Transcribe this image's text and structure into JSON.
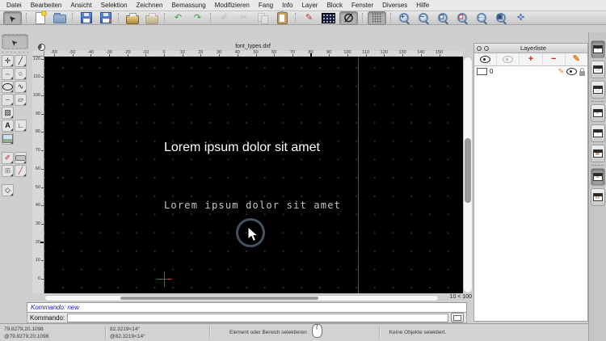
{
  "menubar": {
    "items": [
      "Datei",
      "Bearbeiten",
      "Ansicht",
      "Selektion",
      "Zeichnen",
      "Bemassung",
      "Modifizieren",
      "Fang",
      "Info",
      "Layer",
      "Block",
      "Fenster",
      "Diverses",
      "Hilfe"
    ]
  },
  "toolbar": {
    "buttons": [
      {
        "name": "selection-tool",
        "type": "glyph",
        "glyph": "➤",
        "cls": "rot-nw",
        "color": "#2a2a2a",
        "state": "pressed"
      },
      {
        "sep": true
      },
      {
        "name": "new-file",
        "type": "css",
        "cls": "ic-page new"
      },
      {
        "name": "open-file",
        "type": "css",
        "cls": "ic-folder"
      },
      {
        "sep": true
      },
      {
        "name": "save",
        "type": "css",
        "cls": "ic-floppy"
      },
      {
        "name": "save-as",
        "type": "css",
        "cls": "ic-floppy",
        "overlay": "✎",
        "overlayColor": "#e0a020"
      },
      {
        "sep": true
      },
      {
        "name": "print",
        "type": "css",
        "cls": "ic-printer"
      },
      {
        "name": "print-preview",
        "type": "css",
        "cls": "ic-printer",
        "state": "disabled"
      },
      {
        "sep": true
      },
      {
        "name": "undo",
        "type": "glyph",
        "glyph": "↶",
        "color": "#3f9a3f"
      },
      {
        "name": "redo",
        "type": "glyph",
        "glyph": "↷",
        "color": "#3f9a3f"
      },
      {
        "sep": true
      },
      {
        "name": "drawing-preferences",
        "type": "glyph",
        "glyph": "✐",
        "color": "#9a8f86",
        "state": "disabled"
      },
      {
        "name": "cut",
        "type": "glyph",
        "glyph": "✂",
        "color": "#8a8a8a",
        "state": "disabled"
      },
      {
        "name": "copy",
        "type": "css",
        "cls": "ic-copy",
        "state": "disabled"
      },
      {
        "name": "paste",
        "type": "css",
        "cls": "ic-clipboard"
      },
      {
        "sep": true
      },
      {
        "name": "edit-properties",
        "type": "glyph",
        "glyph": "✎",
        "color": "#c03030"
      },
      {
        "name": "statistics",
        "type": "css",
        "cls": "ic-stats"
      },
      {
        "name": "snap-free",
        "type": "glyph",
        "glyph": "∅",
        "color": "#111111",
        "state": "pressed",
        "big": true
      },
      {
        "sep": true
      },
      {
        "name": "grid-toggle",
        "type": "css",
        "cls": "ic-grid",
        "state": "pressed"
      },
      {
        "sep": true
      },
      {
        "name": "zoom-in",
        "type": "mag",
        "overlay": "+",
        "overlayColor": "#2a4a7a"
      },
      {
        "name": "zoom-out",
        "type": "mag",
        "overlay": "−",
        "overlayColor": "#2a4a7a"
      },
      {
        "name": "zoom-auto",
        "type": "mag",
        "overlay": "◻",
        "overlayColor": "#2a4a7a"
      },
      {
        "name": "zoom-selection",
        "type": "mag",
        "overlay": "◻",
        "overlayColor": "#c03030"
      },
      {
        "name": "zoom-previous",
        "type": "mag",
        "overlay": "←",
        "overlayColor": "#2a4a7a"
      },
      {
        "name": "zoom-window",
        "type": "mag",
        "overlay": "▣",
        "overlayColor": "#2a4a7a"
      },
      {
        "name": "pan",
        "type": "glyph",
        "glyph": "✜",
        "color": "#4a78b8"
      }
    ]
  },
  "left_toolbar": {
    "tools": [
      {
        "name": "point-tool",
        "glyph": "✛"
      },
      {
        "name": "line-tool",
        "glyph": "╱"
      },
      {
        "name": "arc-tool",
        "glyph": "⌢"
      },
      {
        "name": "circle-tool",
        "glyph": "○"
      },
      {
        "name": "ellipse-tool",
        "type": "css",
        "cls": "ic-oval"
      },
      {
        "name": "spline-tool",
        "glyph": "∿"
      },
      {
        "name": "polyline-tool",
        "glyph": "⌣"
      },
      {
        "name": "shape-tool",
        "glyph": "▱"
      },
      {
        "name": "hatch-tool",
        "glyph": "▨"
      },
      {
        "spacer": true
      },
      {
        "name": "text-tool",
        "glyph": "A",
        "bold": true
      },
      {
        "name": "dimension-tool",
        "glyph": "∟"
      },
      {
        "name": "image-tool",
        "type": "css",
        "cls": "ic-photo"
      },
      {
        "spacer": true
      },
      {
        "gap": true
      },
      {
        "name": "modify-tool",
        "glyph": "✐",
        "color": "#c03030"
      },
      {
        "name": "trim-tool",
        "type": "css",
        "cls": "ic-pill"
      },
      {
        "name": "explode-tool",
        "glyph": "⊞",
        "color": "#777777"
      },
      {
        "name": "divide-tool",
        "glyph": "╱",
        "color": "#c03030"
      },
      {
        "gap": true
      },
      {
        "name": "box-3d-tool",
        "glyph": "◇"
      }
    ]
  },
  "document": {
    "title": "font_types.dxf",
    "zoom_indicator": "10 < 100"
  },
  "rulers": {
    "h_labels": [
      -60,
      -50,
      -40,
      -30,
      -20,
      -10,
      0,
      10,
      20,
      30,
      40,
      50,
      60,
      70,
      80,
      90,
      100,
      110,
      120,
      130,
      140,
      150
    ],
    "v_labels": [
      120,
      110,
      100,
      90,
      80,
      70,
      60,
      50,
      40,
      30,
      20,
      10,
      0
    ]
  },
  "canvas": {
    "text_sans": "Lorem ipsum dolor sit amet",
    "text_cad": "Lorem ipsum dolor sit amet"
  },
  "command": {
    "history": "Kommando: new",
    "label": "Kommando:",
    "input_value": ""
  },
  "statusbar": {
    "abs_coord": "79.8279,20.1098",
    "rel_coord": "@79.8279,20.1098",
    "abs_polar": "82.3219<14°",
    "rel_polar": "@82.3219<14°",
    "hint": "Element oder Bereich selektieren",
    "selection_info": "Keine Objekte selektiert."
  },
  "layer_panel": {
    "title": "Layerliste",
    "toolbar": [
      {
        "name": "show-all-layers",
        "type": "eye",
        "color": "#222222"
      },
      {
        "name": "hide-all-layers",
        "type": "eye",
        "color": "#b4b4b4"
      },
      {
        "name": "add-layer",
        "glyph": "+",
        "color": "#cc2222"
      },
      {
        "name": "remove-layer",
        "glyph": "−",
        "color": "#cc2222"
      },
      {
        "name": "edit-layer",
        "glyph": "✎",
        "color": "#e08020"
      }
    ],
    "layers": [
      {
        "name": "0"
      }
    ]
  },
  "right_dock": {
    "buttons": [
      {
        "name": "dock-property-editor",
        "glyph": "✎",
        "pressed": true
      },
      {
        "name": "dock-block-list",
        "glyph": "❏"
      },
      {
        "name": "dock-library-browser",
        "glyph": "▢"
      },
      {
        "sep": true
      },
      {
        "name": "dock-layer-list",
        "glyph": "≡"
      },
      {
        "name": "dock-command-line",
        "glyph": "T"
      },
      {
        "name": "dock-image-panel",
        "glyph": "▦"
      },
      {
        "sep": true
      },
      {
        "name": "dock-text-panel",
        "glyph": "≣",
        "pressed": true
      },
      {
        "name": "dock-clipboard-panel",
        "glyph": "▤"
      }
    ]
  },
  "colors": {
    "accent_red": "#d42a2a",
    "canvas_bg": "#000000",
    "command_blue": "#1515cc"
  }
}
